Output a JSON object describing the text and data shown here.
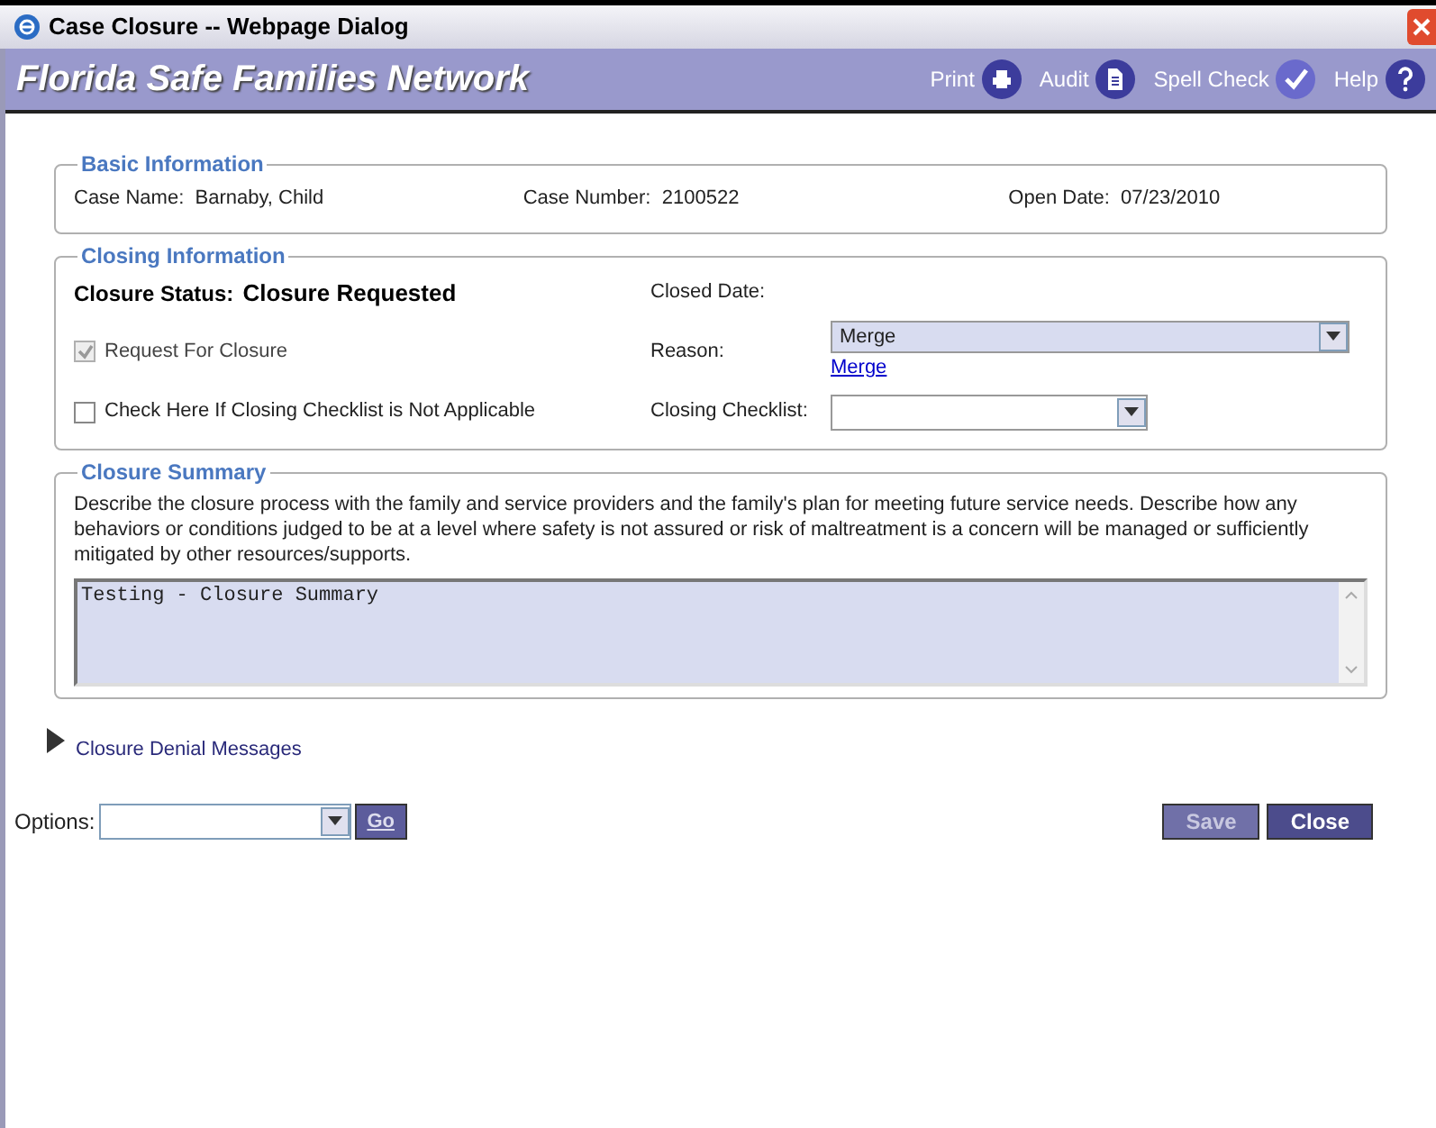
{
  "window": {
    "title": "Case Closure -- Webpage Dialog"
  },
  "header": {
    "title": "Florida Safe Families Network",
    "actions": [
      {
        "label": "Print",
        "kind": "print"
      },
      {
        "label": "Audit",
        "kind": "audit"
      },
      {
        "label": "Spell Check",
        "kind": "spell"
      },
      {
        "label": "Help",
        "kind": "help"
      }
    ]
  },
  "basic_information": {
    "legend": "Basic Information",
    "fields": [
      {
        "label": "Case Name:",
        "value": "Barnaby, Child"
      },
      {
        "label": "Case Number:",
        "value": "2100522"
      },
      {
        "label": "Open Date:",
        "value": "07/23/2010"
      }
    ]
  },
  "closing_information": {
    "legend": "Closing Information",
    "status_label": "Closure Status:",
    "status_value": "Closure Requested",
    "closed_date_label": "Closed Date:",
    "checkboxes": [
      {
        "label": "Request For Closure",
        "checked": true,
        "disabled": true
      },
      {
        "label": "Check Here If Closing Checklist is Not Applicable",
        "checked": false,
        "disabled": false
      }
    ],
    "reason_label": "Reason:",
    "reason_value": "Merge",
    "reason_link": "Merge",
    "checklist_label": "Closing Checklist:"
  },
  "closure_summary": {
    "legend": "Closure Summary",
    "description": "Describe the closure process with the family and service providers and the family's plan for meeting future service needs. Describe how any behaviors or conditions judged to be at a level where safety is not assured or risk of maltreatment is a concern will be managed or sufficiently mitigated by other resources/supports.",
    "value": "Testing - Closure Summary"
  },
  "denial_messages": {
    "label": "Closure Denial Messages",
    "expanded": false
  },
  "options": {
    "label": "Options:",
    "go": "Go"
  },
  "buttons": [
    {
      "label": "Save",
      "disabled": true
    },
    {
      "label": "Close",
      "disabled": false
    }
  ]
}
